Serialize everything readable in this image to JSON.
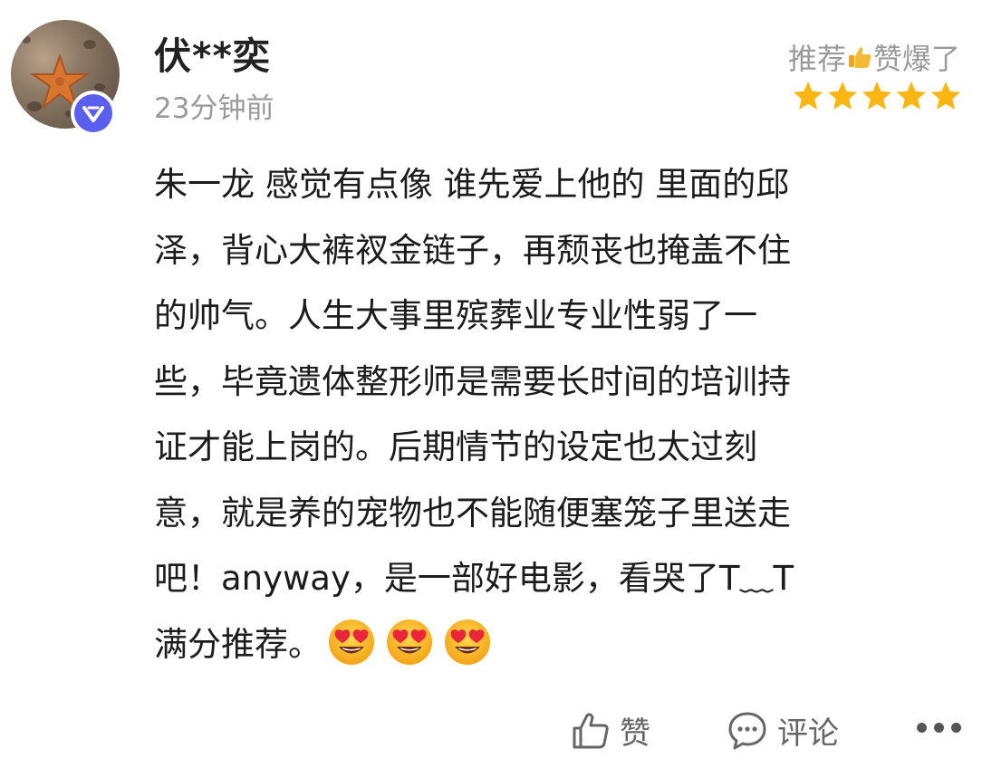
{
  "review": {
    "username": "伏**奕",
    "timestamp": "23分钟前",
    "rating_label_pre": "推荐",
    "rating_label_post": "赞爆了",
    "star_count": 5,
    "star_color": "#fbb614",
    "content_lines": [
      "朱一龙 感觉有点像 谁先爱上他的 里面的邱",
      "泽，背心大裤衩金链子，再颓丧也掩盖不住",
      "的帅气。人生大事里殡葬业专业性弱了一",
      "些，毕竟遗体整形师是需要长时间的培训持",
      "证才能上岗的。后期情节的设定也太过刻",
      "意，就是养的宠物也不能随便塞笼子里送走",
      "吧！anyway，是一部好电影，看哭了T﹏T",
      "满分推荐。"
    ],
    "emoji_count": 3
  },
  "actions": {
    "like_label": "赞",
    "comment_label": "评论"
  },
  "colors": {
    "verify_badge": "#5b5ff0",
    "muted_text": "#9a9a9a"
  },
  "icons": {
    "verify": "verified-badge-icon",
    "like": "thumbs-up-icon",
    "comment": "comment-bubble-icon",
    "more": "more-dots-icon",
    "star": "star-icon",
    "emoji": "heart-eyes-emoji-icon"
  }
}
